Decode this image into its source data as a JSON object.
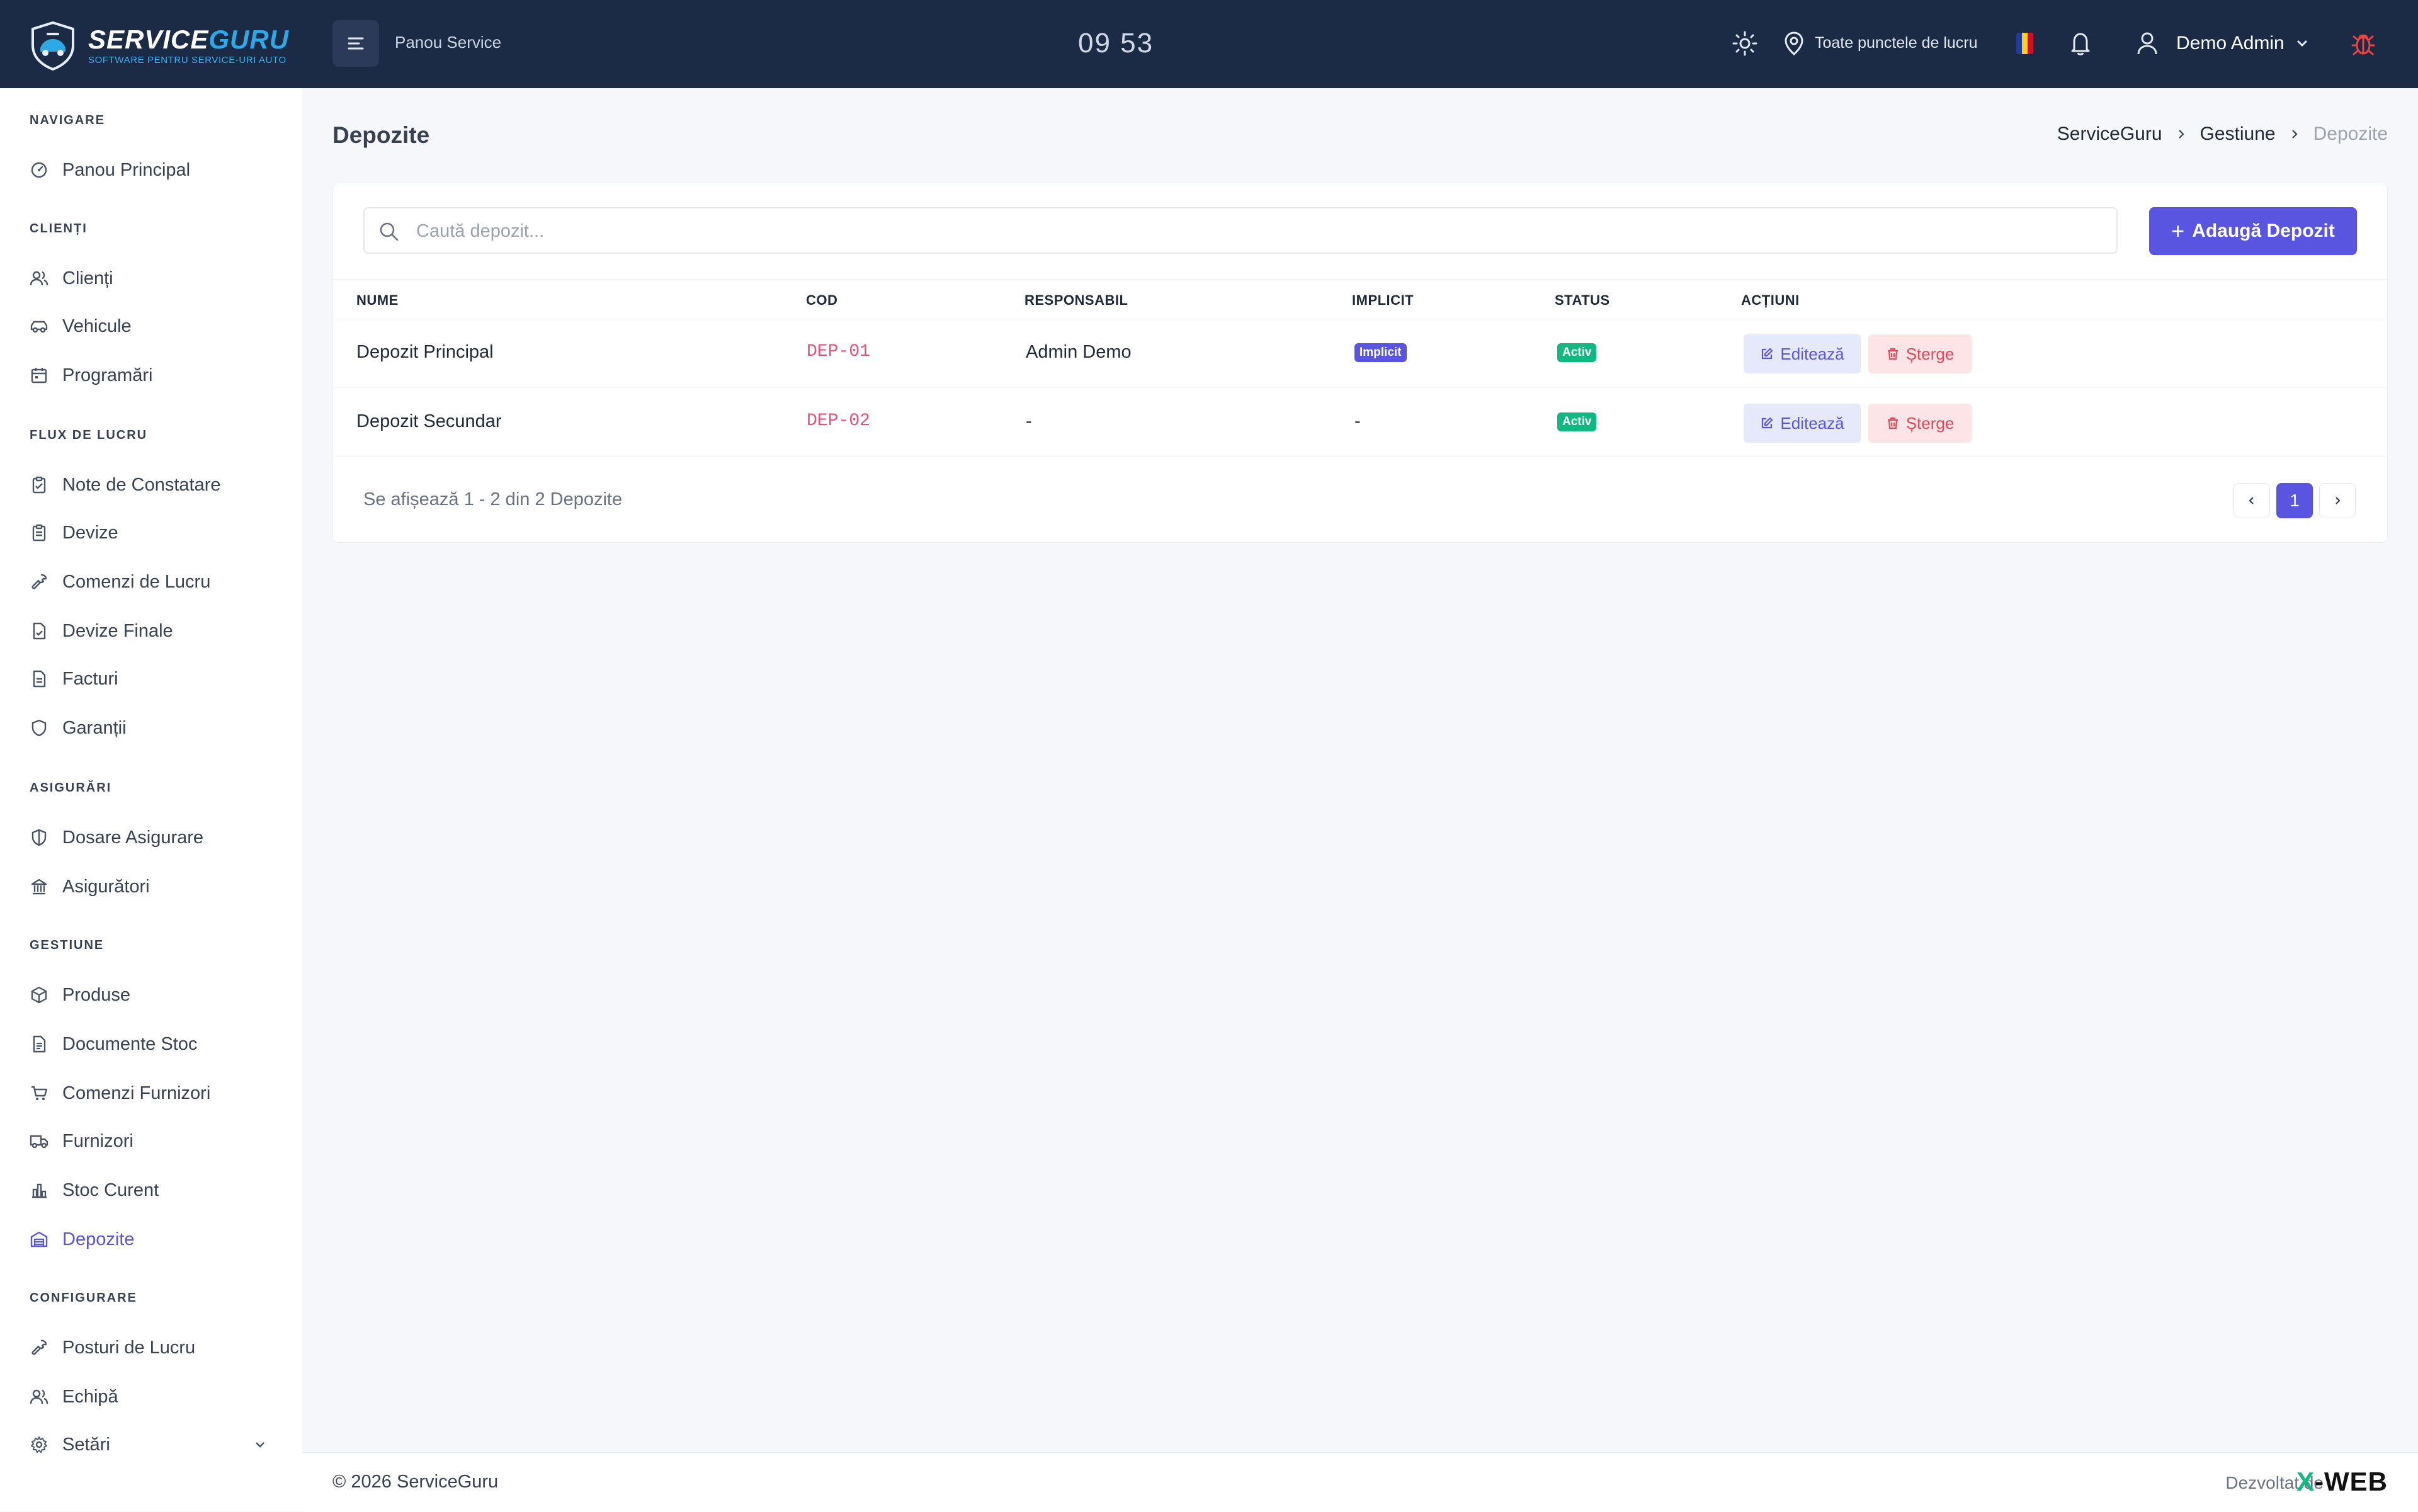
{
  "header": {
    "logo_name_1": "SERVICE",
    "logo_name_2": "GURU",
    "logo_tagline": "SOFTWARE PENTRU SERVICE-URI AUTO",
    "panel_title": "Panou Service",
    "clock": "09 53",
    "location_label": "Toate punctele de lucru",
    "user_name": "Demo Admin"
  },
  "sidebar": {
    "sections": [
      {
        "title": "NAVIGARE",
        "items": [
          {
            "label": "Panou Principal",
            "icon": "dashboard-icon"
          }
        ]
      },
      {
        "title": "CLIENȚI",
        "items": [
          {
            "label": "Clienți",
            "icon": "users-icon"
          },
          {
            "label": "Vehicule",
            "icon": "car-icon"
          },
          {
            "label": "Programări",
            "icon": "calendar-icon"
          }
        ]
      },
      {
        "title": "FLUX DE LUCRU",
        "items": [
          {
            "label": "Note de Constatare",
            "icon": "clipboard-icon"
          },
          {
            "label": "Devize",
            "icon": "clipboard-list-icon"
          },
          {
            "label": "Comenzi de Lucru",
            "icon": "wrench-icon"
          },
          {
            "label": "Devize Finale",
            "icon": "file-check-icon"
          },
          {
            "label": "Facturi",
            "icon": "file-text-icon"
          },
          {
            "label": "Garanții",
            "icon": "shield-icon"
          }
        ]
      },
      {
        "title": "ASIGURĂRI",
        "items": [
          {
            "label": "Dosare Asigurare",
            "icon": "shield-half-icon"
          },
          {
            "label": "Asigurători",
            "icon": "building-icon"
          }
        ]
      },
      {
        "title": "GESTIUNE",
        "items": [
          {
            "label": "Produse",
            "icon": "box-icon"
          },
          {
            "label": "Documente Stoc",
            "icon": "document-icon"
          },
          {
            "label": "Comenzi Furnizori",
            "icon": "cart-icon"
          },
          {
            "label": "Furnizori",
            "icon": "truck-icon"
          },
          {
            "label": "Stoc Curent",
            "icon": "bar-chart-icon"
          },
          {
            "label": "Depozite",
            "icon": "warehouse-icon"
          }
        ]
      },
      {
        "title": "CONFIGURARE",
        "items": [
          {
            "label": "Posturi de Lucru",
            "icon": "tool-icon"
          },
          {
            "label": "Echipă",
            "icon": "team-icon"
          },
          {
            "label": "Setări",
            "icon": "settings-icon"
          }
        ]
      }
    ],
    "active": "Depozite"
  },
  "main": {
    "page_title": "Depozite",
    "breadcrumb": [
      "ServiceGuru",
      "Gestiune",
      "Depozite"
    ],
    "search_placeholder": "Caută depozit...",
    "add_button": "Adaugă Depozit",
    "columns": [
      "NUME",
      "COD",
      "RESPONSABIL",
      "IMPLICIT",
      "STATUS",
      "ACȚIUNI"
    ],
    "rows": [
      {
        "name": "Depozit Principal",
        "code": "DEP-01",
        "responsible": "Admin Demo",
        "implicit": "Implicit",
        "status": "Activ",
        "edit": "Editează",
        "delete": "Șterge"
      },
      {
        "name": "Depozit Secundar",
        "code": "DEP-02",
        "responsible": "-",
        "implicit": "-",
        "status": "Activ",
        "edit": "Editează",
        "delete": "Șterge"
      }
    ],
    "pagination_info": "Se afișează 1 - 2 din 2 Depozite",
    "current_page": "1"
  },
  "footer": {
    "copyright": "© 2026 ServiceGuru",
    "developed_by": "Dezvoltat de",
    "brand_x": "X",
    "brand_rest": "-WEB"
  },
  "colors": {
    "topbar": "#1b2a45",
    "accent": "#5a55e0",
    "active_badge": "#10b981",
    "code_text": "#e5527a",
    "delete_text": "#e04a5a"
  }
}
